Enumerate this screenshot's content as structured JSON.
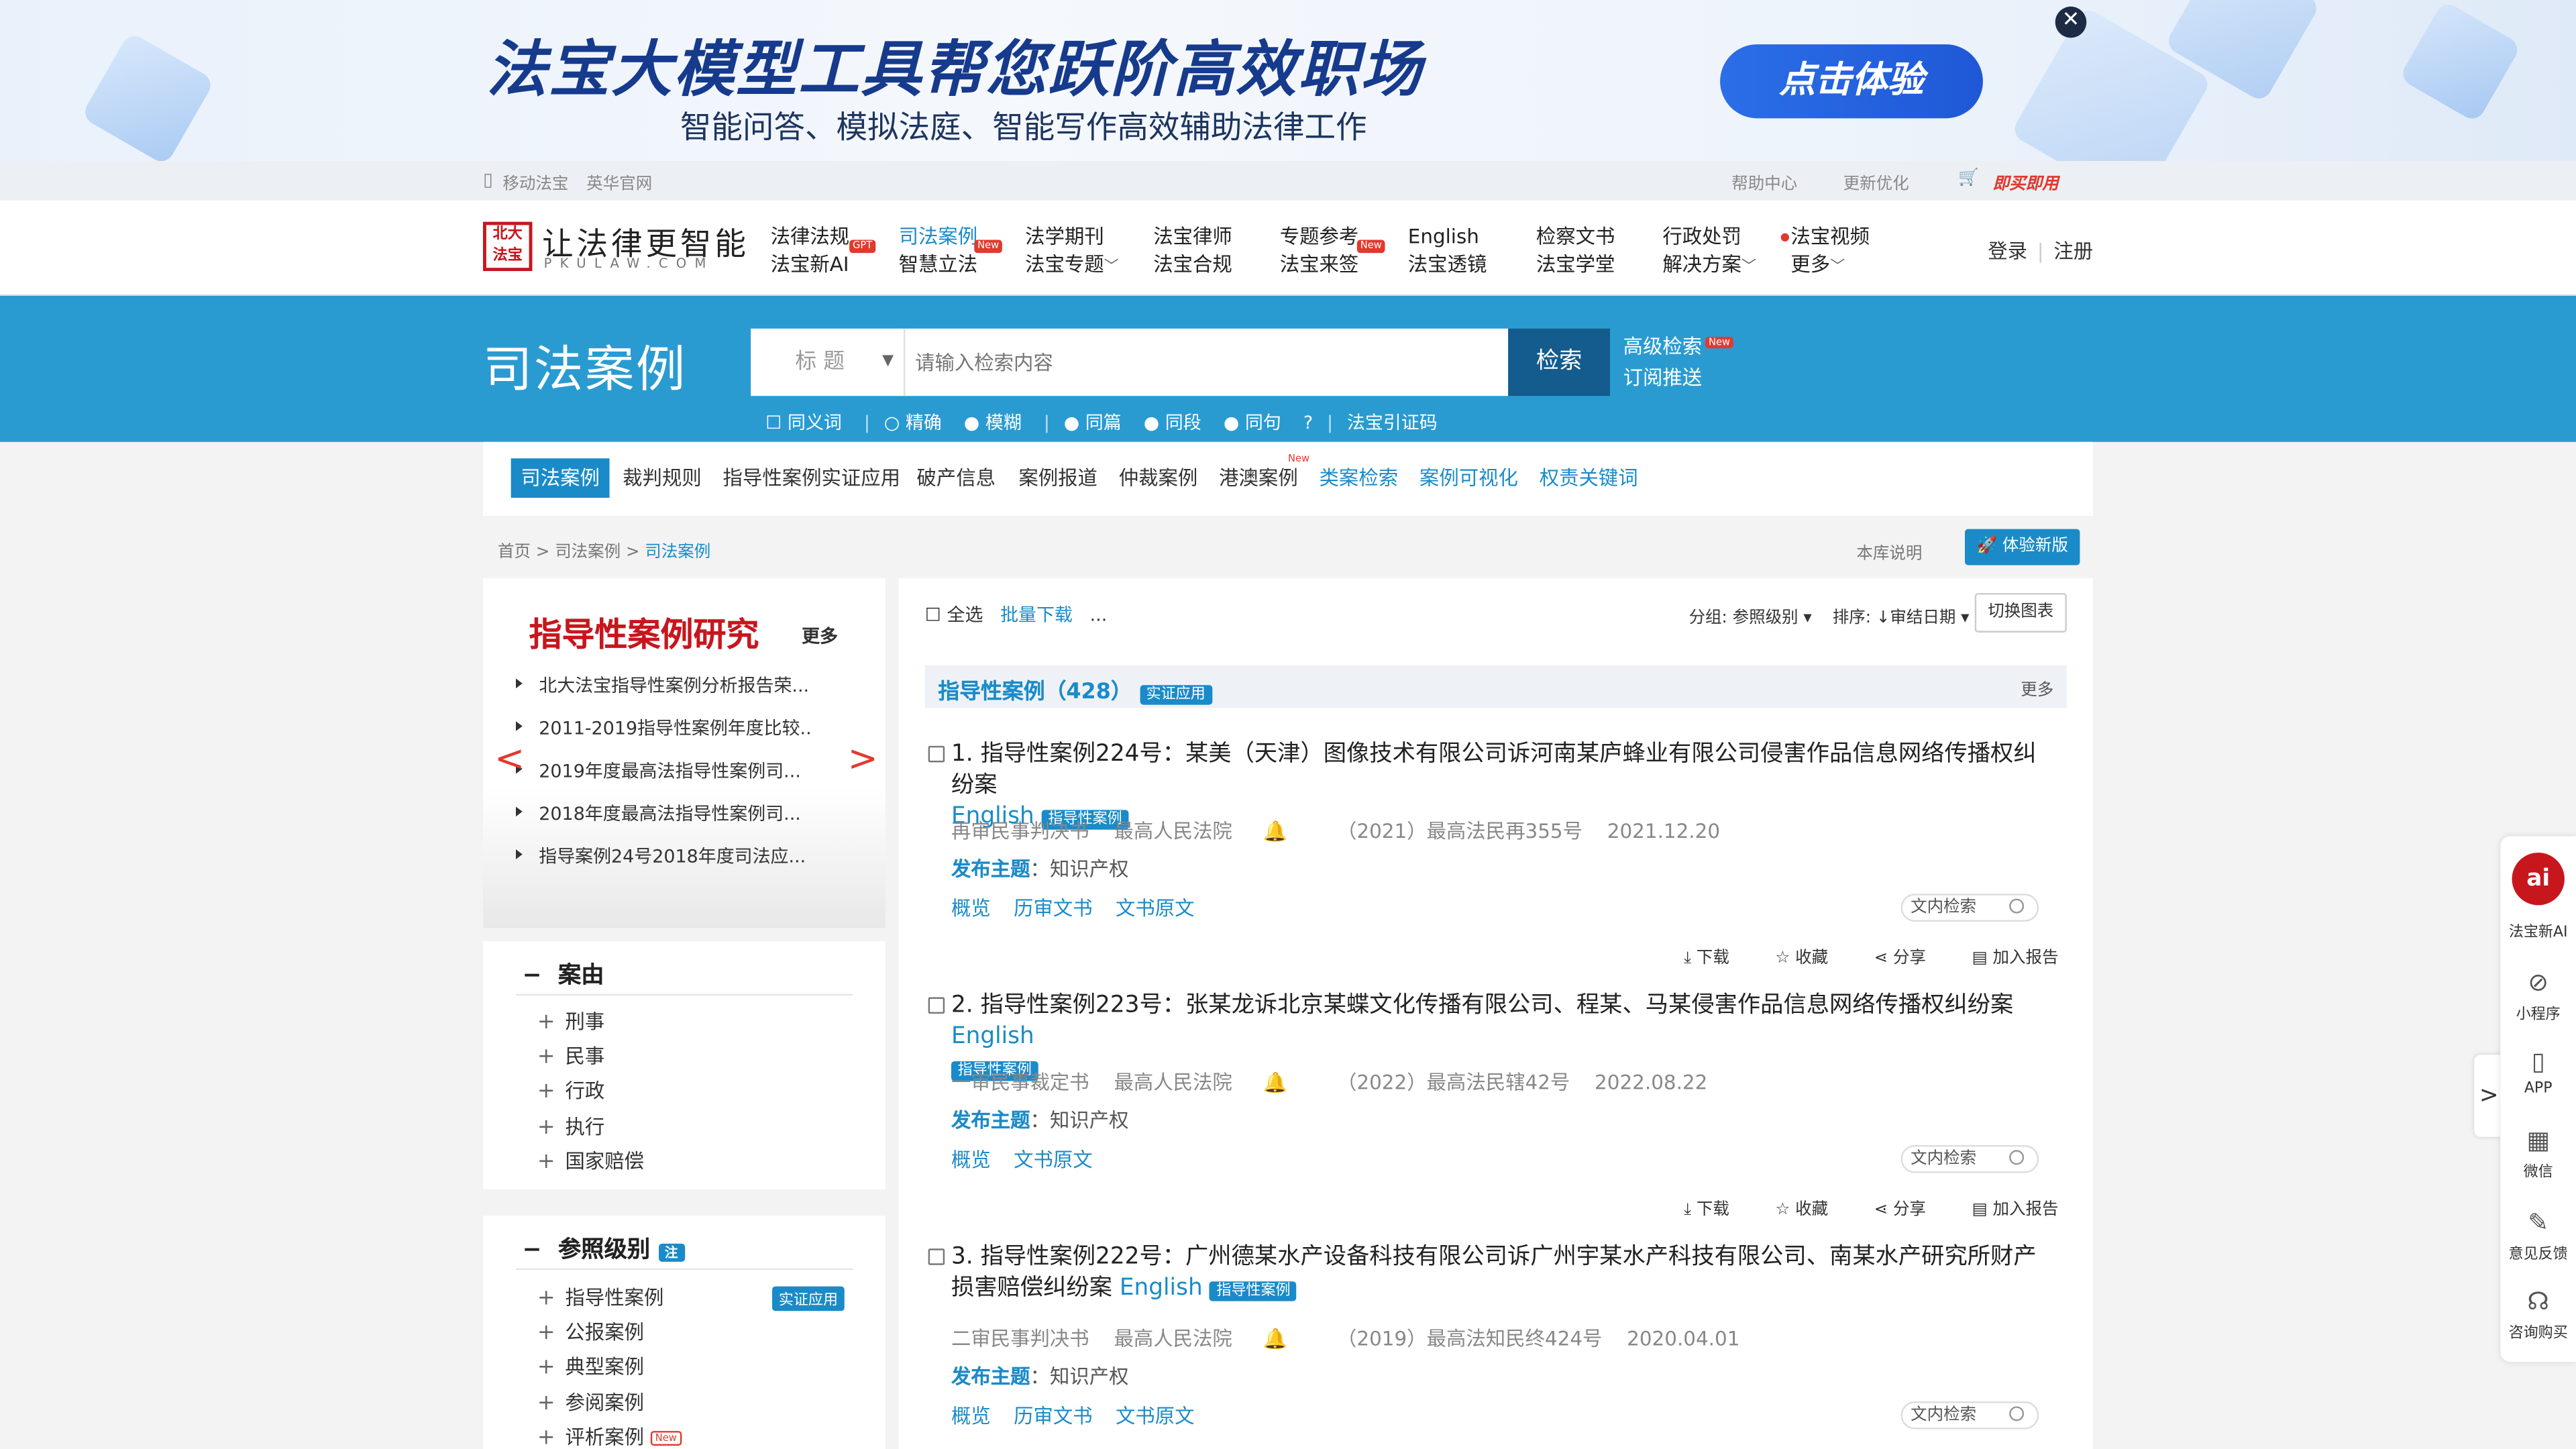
{
  "banner": {
    "title": "法宝大模型工具帮您跃阶高效职场",
    "subtitle": "智能问答、模拟法庭、智能写作高效辅助法律工作",
    "cta": "点击体验",
    "close": "✕"
  },
  "topbar": {
    "mobile": "移动法宝",
    "yinghua": "英华官网",
    "help": "帮助中心",
    "update": "更新优化",
    "buy": "即买即用"
  },
  "logo": {
    "seal": "北大法宝",
    "brand": "让法律更智能",
    "url": "PKULAW.COM"
  },
  "nav": [
    {
      "top": "法律法规",
      "bottom": "法宝新AI",
      "badge": "GPT"
    },
    {
      "top": "司法案例",
      "bottom": "智慧立法",
      "badge": "New"
    },
    {
      "top": "法学期刊",
      "bottom": "法宝专题"
    },
    {
      "top": "法宝律师",
      "bottom": "法宝合规"
    },
    {
      "top": "专题参考",
      "bottom": "法宝来签",
      "badge": "New"
    },
    {
      "top": "English",
      "bottom": "法宝透镜"
    },
    {
      "top": "检察文书",
      "bottom": "法宝学堂"
    },
    {
      "top": "行政处罚",
      "bottom": "解决方案"
    },
    {
      "top": "法宝视频",
      "bottom": "更多"
    }
  ],
  "auth": {
    "login": "登录",
    "register": "注册"
  },
  "search": {
    "section": "司法案例",
    "scope": "标 题",
    "placeholder": "请输入检索内容",
    "button": "检索",
    "advanced": "高级检索",
    "subscribe": "订阅推送",
    "new": "New",
    "options": [
      "同义词",
      "精确",
      "模糊",
      "同篇",
      "同段",
      "同句",
      "法宝引证码"
    ]
  },
  "tabs": [
    "司法案例",
    "裁判规则",
    "指导性案例实证应用",
    "破产信息",
    "案例报道",
    "仲裁案例",
    "港澳案例",
    "类案检索",
    "案例可视化",
    "权责关键词"
  ],
  "tabs_new": "New",
  "breadcrumb": {
    "home": "首页",
    "level1": "司法案例",
    "current": "司法案例",
    "sep": ">"
  },
  "lib_note": "本库说明",
  "new_version": "体验新版",
  "promo": {
    "title": "指导性案例研究",
    "more": "更多",
    "items": [
      "北大法宝指导性案例分析报告荣...",
      "2011-2019指导性案例年度比较..",
      "2019年度最高法指导性案例司...",
      "2018年度最高法指导性案例司...",
      "指导案例24号2018年度司法应..."
    ],
    "prev": "<",
    "next": ">"
  },
  "facet_cause": {
    "title": "案由",
    "items": [
      "刑事",
      "民事",
      "行政",
      "执行",
      "国家赔偿"
    ]
  },
  "facet_level": {
    "title": "参照级别",
    "note": "注",
    "items": [
      "指导性案例",
      "公报案例",
      "典型案例",
      "参阅案例",
      "评析案例"
    ],
    "tag": "实证应用",
    "new": "New"
  },
  "toolbar": {
    "select_all": "全选",
    "batch_download": "批量下载",
    "more": "...",
    "group": "分组: 参照级别",
    "sort": "排序: ↓审结日期",
    "switch": "切换图表"
  },
  "group": {
    "title": "指导性案例（428）",
    "tag": "实证应用",
    "more": "更多"
  },
  "results": [
    {
      "title": "1. 指导性案例224号：某美（天津）图像技术有限公司诉河南某庐蜂业有限公司侵害作品信息网络传播权纠纷案",
      "english": "English",
      "tag": "指导性案例",
      "doc_type": "再审民事判决书",
      "court": "最高人民法院",
      "case_no": "（2021）最高法民再355号",
      "date": "2021.12.20",
      "topic_label": "发布主题",
      "topic": "知识产权",
      "links": [
        "概览",
        "历审文书",
        "文书原文"
      ]
    },
    {
      "title": "2. 指导性案例223号：张某龙诉北京某蝶文化传播有限公司、程某、马某侵害作品信息网络传播权纠纷案",
      "english": "English",
      "tag": "指导性案例",
      "doc_type": "一审民事裁定书",
      "court": "最高人民法院",
      "case_no": "（2022）最高法民辖42号",
      "date": "2022.08.22",
      "topic_label": "发布主题",
      "topic": "知识产权",
      "links": [
        "概览",
        "文书原文"
      ]
    },
    {
      "title": "3. 指导性案例222号：广州德某水产设备科技有限公司诉广州宇某水产科技有限公司、南某水产研究所财产损害赔偿纠纷案",
      "english": "English",
      "tag": "指导性案例",
      "doc_type": "二审民事判决书",
      "court": "最高人民法院",
      "case_no": "（2019）最高法知民终424号",
      "date": "2020.04.01",
      "topic_label": "发布主题",
      "topic": "知识产权",
      "links": [
        "概览",
        "历审文书",
        "文书原文"
      ]
    }
  ],
  "result_search": "文内检索",
  "result_actions": [
    "下载",
    "收藏",
    "分享",
    "加入报告"
  ],
  "rail": {
    "ai_logo": "ai",
    "items": [
      "法宝新AI",
      "小程序",
      "APP",
      "微信",
      "意见反馈",
      "咨询购买"
    ],
    "toggle": ">"
  }
}
